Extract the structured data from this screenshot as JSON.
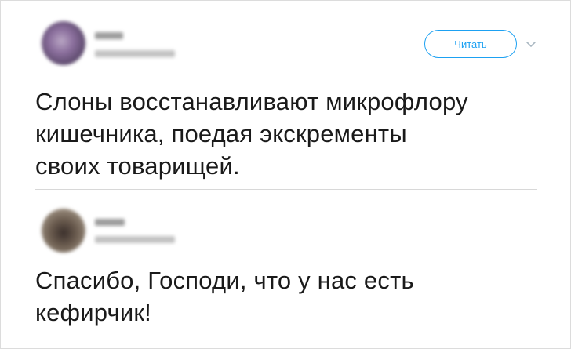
{
  "tweets": [
    {
      "follow_label": "Читать",
      "text_lines": [
        "Слоны восстанавливают микрофлору",
        "кишечника, поедая экскременты",
        "своих товарищей."
      ]
    },
    {
      "text_lines": [
        "Спасибо, Господи, что у нас есть",
        "кефирчик!"
      ]
    }
  ],
  "colors": {
    "accent": "#1da1f2",
    "text": "#1a1a1a",
    "divider": "#d8d8d8"
  },
  "icons": {
    "menu": "chevron-down-icon"
  }
}
